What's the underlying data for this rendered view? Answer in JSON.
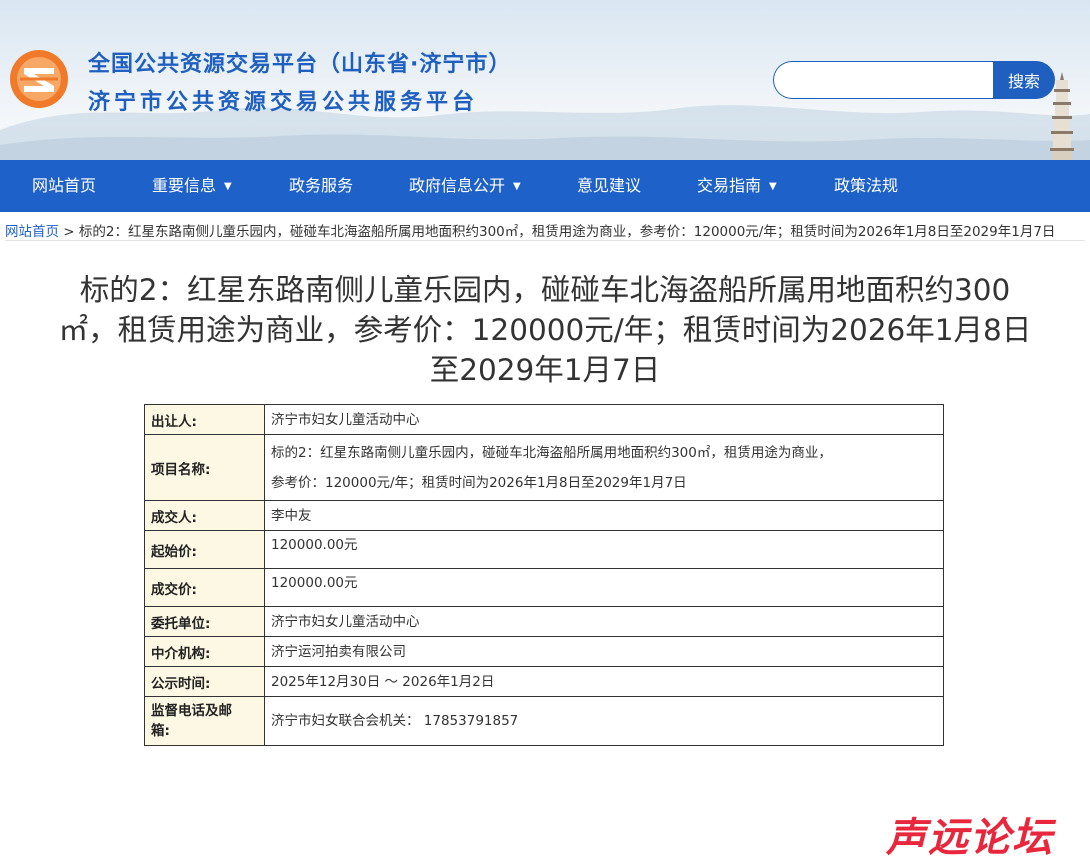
{
  "header": {
    "title_line1": "全国公共资源交易平台（山东省·济宁市）",
    "title_line2": "济宁市公共资源交易公共服务平台",
    "search_placeholder": "",
    "search_button": "搜索"
  },
  "nav": {
    "items": [
      {
        "label": "网站首页",
        "dropdown": false
      },
      {
        "label": "重要信息",
        "dropdown": true
      },
      {
        "label": "政务服务",
        "dropdown": false
      },
      {
        "label": "政府信息公开",
        "dropdown": true
      },
      {
        "label": "意见建议",
        "dropdown": false
      },
      {
        "label": "交易指南",
        "dropdown": true
      },
      {
        "label": "政策法规",
        "dropdown": false
      }
    ]
  },
  "breadcrumb": {
    "home": "网站首页",
    "separator": ">",
    "current": "标的2：红星东路南侧儿童乐园内，碰碰车北海盗船所属用地面积约300㎡，租赁用途为商业，参考价：120000元/年；租赁时间为2026年1月8日至2029年1月7日"
  },
  "article": {
    "title_line1": "标的2：红星东路南侧儿童乐园内，碰碰车北海盗船所属用地面积约300",
    "title_line2": "㎡，租赁用途为商业，参考价：120000元/年；租赁时间为2026年1月8日",
    "title_line3": "至2029年1月7日"
  },
  "details": {
    "rows": [
      {
        "key": "出让人:",
        "value": "济宁市妇女儿童活动中心"
      },
      {
        "key": "项目名称:",
        "value_line1": "标的2：红星东路南侧儿童乐园内，碰碰车北海盗船所属用地面积约300㎡，租赁用途为商业，",
        "value_line2": "参考价：120000元/年；租赁时间为2026年1月8日至2029年1月7日"
      },
      {
        "key": "成交人:",
        "value": "李中友"
      },
      {
        "key": "起始价:",
        "value": "120000.00元"
      },
      {
        "key": "成交价:",
        "value": "120000.00元"
      },
      {
        "key": "委托单位:",
        "value": "济宁市妇女儿童活动中心"
      },
      {
        "key": "中介机构:",
        "value": "济宁运河拍卖有限公司"
      },
      {
        "key": "公示时间:",
        "value": "2025年12月30日 ～ 2026年1月2日"
      },
      {
        "key_line1": "监督电话及邮",
        "key_line2": "箱:",
        "value": "济宁市妇女联合会机关： 17853791857"
      }
    ]
  },
  "watermark": {
    "text": "声远论坛"
  },
  "colors": {
    "brand_blue": "#1e62c9",
    "label_bg": "#fdf8e4",
    "logo_orange": "#f07a2a",
    "watermark_red": "#e8263c"
  }
}
